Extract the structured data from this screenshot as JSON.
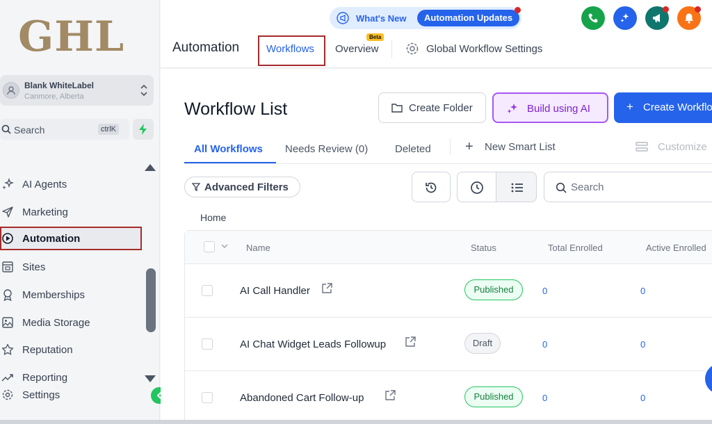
{
  "brand": {
    "logo_text": "GHL"
  },
  "account": {
    "name": "Blank WhiteLabel",
    "location": "Canmore, Alberta"
  },
  "sidebar_search": {
    "label": "Search",
    "shortcut": "ctrlK"
  },
  "sidebar": {
    "items": [
      {
        "label": "AI Agents",
        "icon": "sparkles-icon"
      },
      {
        "label": "Marketing",
        "icon": "send-icon"
      },
      {
        "label": "Automation",
        "icon": "automation-icon",
        "active": true
      },
      {
        "label": "Sites",
        "icon": "sites-icon"
      },
      {
        "label": "Memberships",
        "icon": "award-icon"
      },
      {
        "label": "Media Storage",
        "icon": "image-icon"
      },
      {
        "label": "Reputation",
        "icon": "star-icon"
      },
      {
        "label": "Reporting",
        "icon": "trend-icon"
      },
      {
        "label": "Settings",
        "icon": "gear-icon"
      }
    ]
  },
  "topbar": {
    "whats_new": "What's New",
    "updates_pill": "Automation Updates",
    "page_heading": "Automation",
    "tabs": [
      {
        "label": "Workflows",
        "active": true
      },
      {
        "label": "Overview",
        "badge": "Beta"
      },
      {
        "label": "Global Workflow Settings"
      }
    ]
  },
  "colors": {
    "primary": "#2563eb",
    "ai_purple": "#7e22ce",
    "success": "#22c55e",
    "phone_green": "#16a34a",
    "megaphone_teal": "#0f766e",
    "bell_orange": "#f97316",
    "highlight_box": "#a52a2a"
  },
  "workflow_list": {
    "title": "Workflow List",
    "buttons": {
      "create_folder": "Create Folder",
      "build_ai": "Build using AI",
      "create_workflow": "Create Workflow"
    },
    "tabs": [
      "All Workflows",
      "Needs Review (0)",
      "Deleted"
    ],
    "new_smart_list": "New Smart List",
    "customize": "Customize",
    "advanced_filters": "Advanced Filters",
    "search_placeholder": "Search",
    "breadcrumb": "Home",
    "columns": [
      "Name",
      "Status",
      "Total Enrolled",
      "Active Enrolled"
    ],
    "rows": [
      {
        "name": "AI Call Handler",
        "status": "Published",
        "total": "0",
        "active": "0"
      },
      {
        "name": "AI Chat Widget Leads Followup",
        "status": "Draft",
        "total": "0",
        "active": "0"
      },
      {
        "name": "Abandoned Cart Follow-up",
        "status": "Published",
        "total": "0",
        "active": "0"
      }
    ]
  }
}
